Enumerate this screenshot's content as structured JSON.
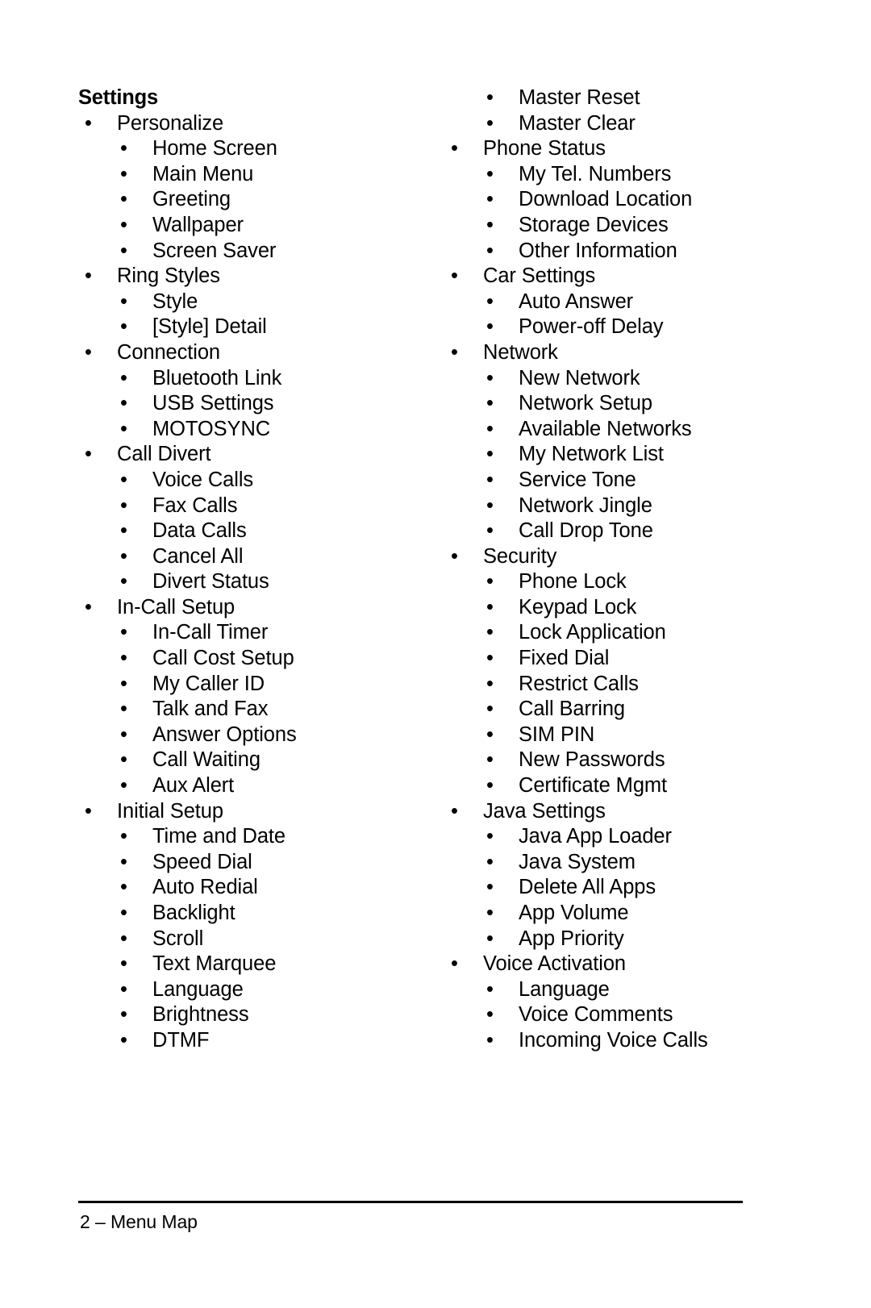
{
  "document": {
    "section_heading": "Settings",
    "bullet_glyph": "•"
  },
  "left_column": {
    "items": [
      {
        "level": 1,
        "label": "Personalize"
      },
      {
        "level": 2,
        "label": "Home Screen"
      },
      {
        "level": 2,
        "label": "Main Menu"
      },
      {
        "level": 2,
        "label": "Greeting"
      },
      {
        "level": 2,
        "label": "Wallpaper"
      },
      {
        "level": 2,
        "label": "Screen Saver"
      },
      {
        "level": 1,
        "label": "Ring Styles"
      },
      {
        "level": 2,
        "label": "Style"
      },
      {
        "level": 2,
        "label": "[Style] Detail"
      },
      {
        "level": 1,
        "label": "Connection"
      },
      {
        "level": 2,
        "label": "Bluetooth Link"
      },
      {
        "level": 2,
        "label": "USB Settings"
      },
      {
        "level": 2,
        "label": "MOTOSYNC"
      },
      {
        "level": 1,
        "label": "Call Divert"
      },
      {
        "level": 2,
        "label": "Voice Calls"
      },
      {
        "level": 2,
        "label": "Fax Calls"
      },
      {
        "level": 2,
        "label": "Data Calls"
      },
      {
        "level": 2,
        "label": "Cancel All"
      },
      {
        "level": 2,
        "label": "Divert Status"
      },
      {
        "level": 1,
        "label": "In-Call Setup"
      },
      {
        "level": 2,
        "label": "In-Call Timer"
      },
      {
        "level": 2,
        "label": "Call Cost Setup"
      },
      {
        "level": 2,
        "label": "My Caller ID"
      },
      {
        "level": 2,
        "label": "Talk and Fax"
      },
      {
        "level": 2,
        "label": "Answer Options"
      },
      {
        "level": 2,
        "label": "Call Waiting"
      },
      {
        "level": 2,
        "label": "Aux Alert"
      },
      {
        "level": 1,
        "label": "Initial Setup"
      },
      {
        "level": 2,
        "label": "Time and Date"
      },
      {
        "level": 2,
        "label": "Speed Dial"
      },
      {
        "level": 2,
        "label": "Auto Redial"
      },
      {
        "level": 2,
        "label": "Backlight"
      },
      {
        "level": 2,
        "label": "Scroll"
      },
      {
        "level": 2,
        "label": "Text Marquee"
      },
      {
        "level": 2,
        "label": "Language"
      },
      {
        "level": 2,
        "label": "Brightness"
      },
      {
        "level": 2,
        "label": "DTMF"
      }
    ]
  },
  "right_column": {
    "items": [
      {
        "level": 2,
        "label": "Master Reset"
      },
      {
        "level": 2,
        "label": "Master Clear"
      },
      {
        "level": 1,
        "label": "Phone Status"
      },
      {
        "level": 2,
        "label": "My Tel. Numbers"
      },
      {
        "level": 2,
        "label": "Download Location"
      },
      {
        "level": 2,
        "label": "Storage Devices"
      },
      {
        "level": 2,
        "label": "Other Information"
      },
      {
        "level": 1,
        "label": "Car Settings"
      },
      {
        "level": 2,
        "label": "Auto Answer"
      },
      {
        "level": 2,
        "label": "Power-off Delay"
      },
      {
        "level": 1,
        "label": "Network"
      },
      {
        "level": 2,
        "label": "New Network"
      },
      {
        "level": 2,
        "label": "Network Setup"
      },
      {
        "level": 2,
        "label": "Available Networks"
      },
      {
        "level": 2,
        "label": "My Network List"
      },
      {
        "level": 2,
        "label": "Service Tone"
      },
      {
        "level": 2,
        "label": "Network Jingle"
      },
      {
        "level": 2,
        "label": "Call Drop Tone"
      },
      {
        "level": 1,
        "label": "Security"
      },
      {
        "level": 2,
        "label": "Phone Lock"
      },
      {
        "level": 2,
        "label": "Keypad Lock"
      },
      {
        "level": 2,
        "label": "Lock Application"
      },
      {
        "level": 2,
        "label": "Fixed Dial"
      },
      {
        "level": 2,
        "label": "Restrict Calls"
      },
      {
        "level": 2,
        "label": "Call Barring"
      },
      {
        "level": 2,
        "label": "SIM PIN"
      },
      {
        "level": 2,
        "label": "New Passwords"
      },
      {
        "level": 2,
        "label": "Certificate Mgmt"
      },
      {
        "level": 1,
        "label": "Java Settings"
      },
      {
        "level": 2,
        "label": "Java App Loader"
      },
      {
        "level": 2,
        "label": "Java System"
      },
      {
        "level": 2,
        "label": "Delete All Apps"
      },
      {
        "level": 2,
        "label": "App Volume"
      },
      {
        "level": 2,
        "label": "App Priority"
      },
      {
        "level": 1,
        "label": "Voice Activation"
      },
      {
        "level": 2,
        "label": "Language"
      },
      {
        "level": 2,
        "label": "Voice Comments"
      },
      {
        "level": 2,
        "label": "Incoming Voice Calls"
      }
    ]
  },
  "footer": {
    "text": "2 – Menu Map"
  }
}
